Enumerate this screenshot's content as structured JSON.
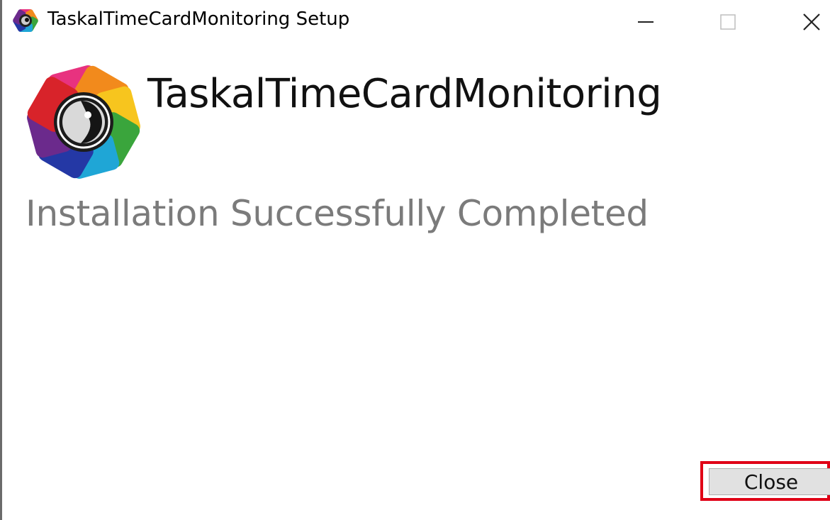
{
  "window": {
    "title": "TaskalTimeCardMonitoring Setup",
    "icon": "app-logo-icon",
    "controls": {
      "minimize_icon": "minimize-icon",
      "maximize_icon": "maximize-icon",
      "close_icon": "close-icon"
    }
  },
  "header": {
    "product_name": "TaskalTimeCardMonitoring",
    "logo_icon": "app-logo-icon"
  },
  "main": {
    "status": "Installation Successfully Completed"
  },
  "footer": {
    "close_label": "Close",
    "highlight_color": "#e00016"
  },
  "colors": {
    "status_text": "#7b7b7b",
    "button_bg": "#e1e1e1"
  }
}
